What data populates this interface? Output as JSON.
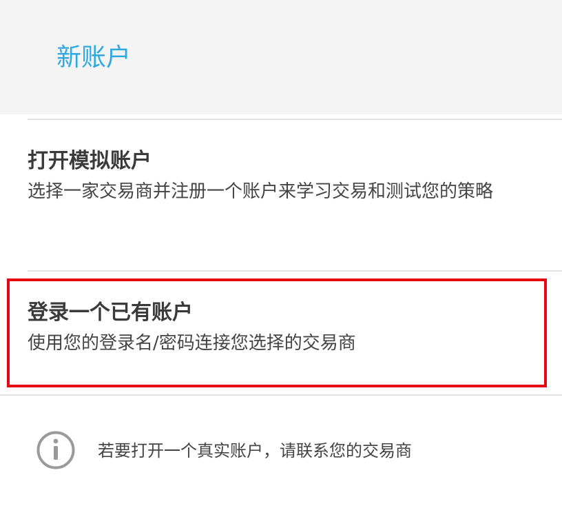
{
  "header": {
    "title": "新账户"
  },
  "options": [
    {
      "title": "打开模拟账户",
      "description": "选择一家交易商并注册一个账户来学习交易和测试您的策略"
    },
    {
      "title": "登录一个已有账户",
      "description": "使用您的登录名/密码连接您选择的交易商"
    }
  ],
  "info": {
    "icon": "info-icon",
    "text": "若要打开一个真实账户，请联系您的交易商"
  },
  "colors": {
    "accent": "#2fa8e0",
    "highlight": "#e5040f",
    "header_bg": "#f4f4f4"
  }
}
